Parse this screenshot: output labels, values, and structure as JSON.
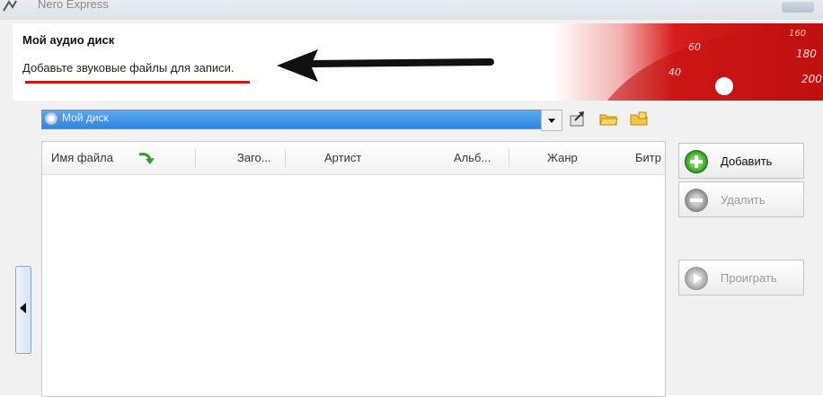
{
  "window": {
    "title": "Nero Express",
    "app_icon": "nero-logo-icon"
  },
  "header": {
    "title": "Мой аудио диск",
    "subtitle": "Добавьте звуковые файлы для записи.",
    "banner_numbers": [
      "160",
      "180",
      "200",
      "40",
      "60"
    ],
    "accent_color": "#d01515"
  },
  "disc": {
    "name": "Мой диск",
    "icon": "cd-icon",
    "dropdown_icon": "chevron-down-icon"
  },
  "toolbar": {
    "export_icon": "export-icon",
    "open_icon": "folder-open-icon",
    "new_folder_icon": "folder-new-icon"
  },
  "file_list": {
    "columns": [
      "Имя файла",
      "Заго...",
      "Артист",
      "Альб...",
      "Жанр",
      "Битр"
    ],
    "rows": []
  },
  "actions": {
    "add_label": "Добавить",
    "delete_label": "Удалить",
    "play_label": "Проиграть"
  }
}
